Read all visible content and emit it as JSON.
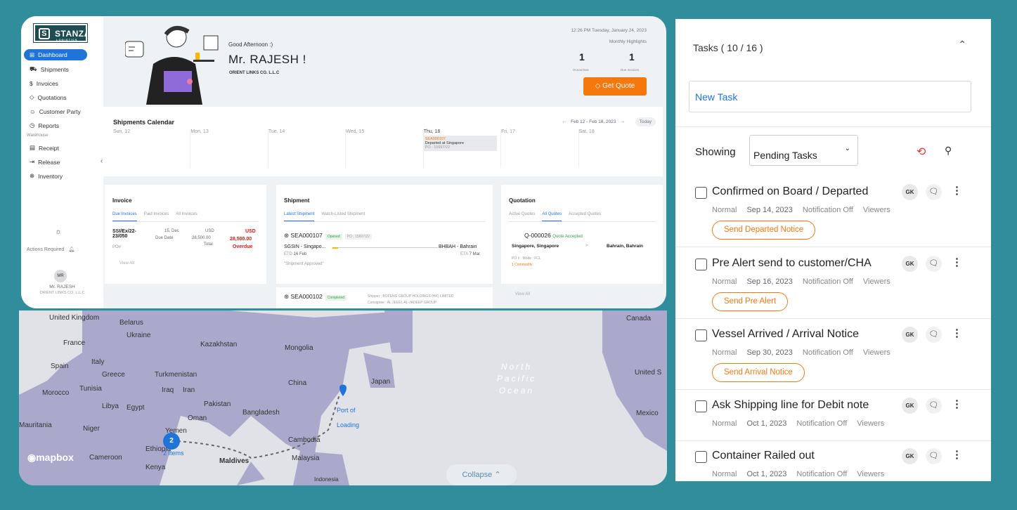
{
  "app": {
    "logo": "STANZA",
    "logo_sub": "LOGISTICS",
    "nav": [
      {
        "label": "Dashboard",
        "icon": "grid-icon",
        "active": true
      },
      {
        "label": "Shipments",
        "icon": "truck-icon"
      },
      {
        "label": "Invoices",
        "icon": "dollar-icon"
      },
      {
        "label": "Quotations",
        "icon": "tag-icon"
      },
      {
        "label": "Customer Party",
        "icon": "users-icon"
      },
      {
        "label": "Reports",
        "icon": "clock-icon"
      }
    ],
    "nav_section": "Warehouse",
    "nav_wh": [
      {
        "label": "Receipt",
        "icon": "doc-icon"
      },
      {
        "label": "Release",
        "icon": "exit-icon"
      },
      {
        "label": "Inventory",
        "icon": "globe-icon"
      }
    ],
    "actions_required": "Actions Required",
    "avatar_initials": "MR",
    "user_short": "Mr. RAJESH",
    "user_company": "ORIENT LINKS CO. L.L.C",
    "header": {
      "greeting": "Good Afternoon :)",
      "name": "Mr. RAJESH !",
      "company": "ORIENT LINKS CO. L.L.C",
      "datetime": "12:26 PM Tuesday, January 24, 2023",
      "monthly": "Monthly Highlights",
      "h1_val": "1",
      "h1_label": "Ocean/Sea",
      "h2_val": "1",
      "h2_label": "Due Invoices",
      "quote_btn": "Get Quote"
    },
    "calendar": {
      "title": "Shipments Calendar",
      "range": "Feb 12 - Feb 18, 2023",
      "today": "Today",
      "days": [
        "Sun, 12",
        "Mon, 13",
        "Tue, 14",
        "Wed, 15",
        "Thu, 16",
        "Fri, 17",
        "Sat, 18"
      ],
      "event": {
        "id": "SEA000107",
        "status": "Departed at Singapore",
        "po": "PO : 15697/22"
      }
    },
    "invoice": {
      "title": "Invoice",
      "tabs": [
        "Due Invoices",
        "Paid Invoices",
        "All Invoices"
      ],
      "row": {
        "no": "SSI/Ex/22-23/050",
        "po": "PO#",
        "date": "15, Dec",
        "date_label": "Due Date",
        "cur": "USD",
        "amt": "28,500.00",
        "total": "Total",
        "due_cur": "USD",
        "due_amt": "28,500.00",
        "due_label": "Overdue"
      },
      "view_all": "View All"
    },
    "shipment": {
      "title": "Shipment",
      "tabs": [
        "Latest Shipment",
        "Watch-Listed Shipment"
      ],
      "s1": {
        "id": "SEA000107",
        "badge": "Opened",
        "po": "PO : 15697/22",
        "from": "SGSIN - Singapo...",
        "to": "BHBAH - Bahrain",
        "etd": "ETD",
        "etd_val": "16 Feb",
        "eta": "ETA",
        "eta_val": "7 Mar",
        "note": "\"Shipment Approved\""
      },
      "s2": {
        "id": "SEA000102",
        "badge": "Completed",
        "shipper": "Shipper : BOFENG GROUP HOLDINGS (HK) LIMITED",
        "consignee": "Consignee : AL JEEEL AL-JADEEP GROUP"
      }
    },
    "quotation": {
      "title": "Quotation",
      "tabs": [
        "Active Quotes",
        "All Quotes",
        "Accepted Quotes"
      ],
      "q": {
        "id": "Q-000026",
        "status": "Quote Accepted",
        "from": "Singapore, Singapore",
        "arrow": ">",
        "to": "Bahrain, Bahrain",
        "mode": "PO # :  Mode : FCL",
        "commodity": "1 Commodity"
      },
      "view_all": "View All"
    }
  },
  "map": {
    "labels": [
      "United Kingdom",
      "Belarus",
      "Ukraine",
      "France",
      "Kazakhstan",
      "Mongolia",
      "Spain",
      "Italy",
      "Greece",
      "Turkmenistan",
      "China",
      "Japan",
      "Morocco",
      "Tunisia",
      "Iraq",
      "Iran",
      "Libya",
      "Egypt",
      "Pakistan",
      "Bangladesh",
      "Mauritania",
      "Niger",
      "Oman",
      "Yemen",
      "Ethiopia",
      "Cambodia",
      "Kenya",
      "Maldives",
      "Malaysia",
      "Canada",
      "United S",
      "Mexico",
      "Cameroon",
      "Indonesia"
    ],
    "ocean": "North Pacific Ocean",
    "pin_count": "2",
    "pin_items": "2 Items",
    "port": "Port of Loading",
    "logo": "mapbox",
    "collapse": "Collapse"
  },
  "tasks": {
    "header": "Tasks ( 10 / 16 )",
    "new_task": "New Task",
    "showing": "Showing",
    "filter": "Pending Tasks",
    "items": [
      {
        "title": "Confirmed on Board / Departed",
        "priority": "Normal",
        "date": "Sep 14, 2023",
        "notif": "Notification Off",
        "viewers": "Viewers",
        "action": "Send Departed Notice",
        "avatar": "GK"
      },
      {
        "title": "Pre Alert send to customer/CHA",
        "priority": "Normal",
        "date": "Sep 16, 2023",
        "notif": "Notification Off",
        "viewers": "Viewers",
        "action": "Send Pre Alert",
        "avatar": "GK"
      },
      {
        "title": "Vessel Arrived / Arrival Notice",
        "priority": "Normal",
        "date": "Sep 30, 2023",
        "notif": "Notification Off",
        "viewers": "Viewers",
        "action": "Send Arrival Notice",
        "avatar": "GK"
      },
      {
        "title": "Ask Shipping line for Debit note",
        "priority": "Normal",
        "date": "Oct 1, 2023",
        "notif": "Notification Off",
        "viewers": "Viewers",
        "action": "",
        "avatar": "GK"
      },
      {
        "title": "Container Railed out",
        "priority": "Normal",
        "date": "Oct 1, 2023",
        "notif": "Notification Off",
        "viewers": "Viewers",
        "action": "",
        "avatar": "GK"
      }
    ]
  }
}
